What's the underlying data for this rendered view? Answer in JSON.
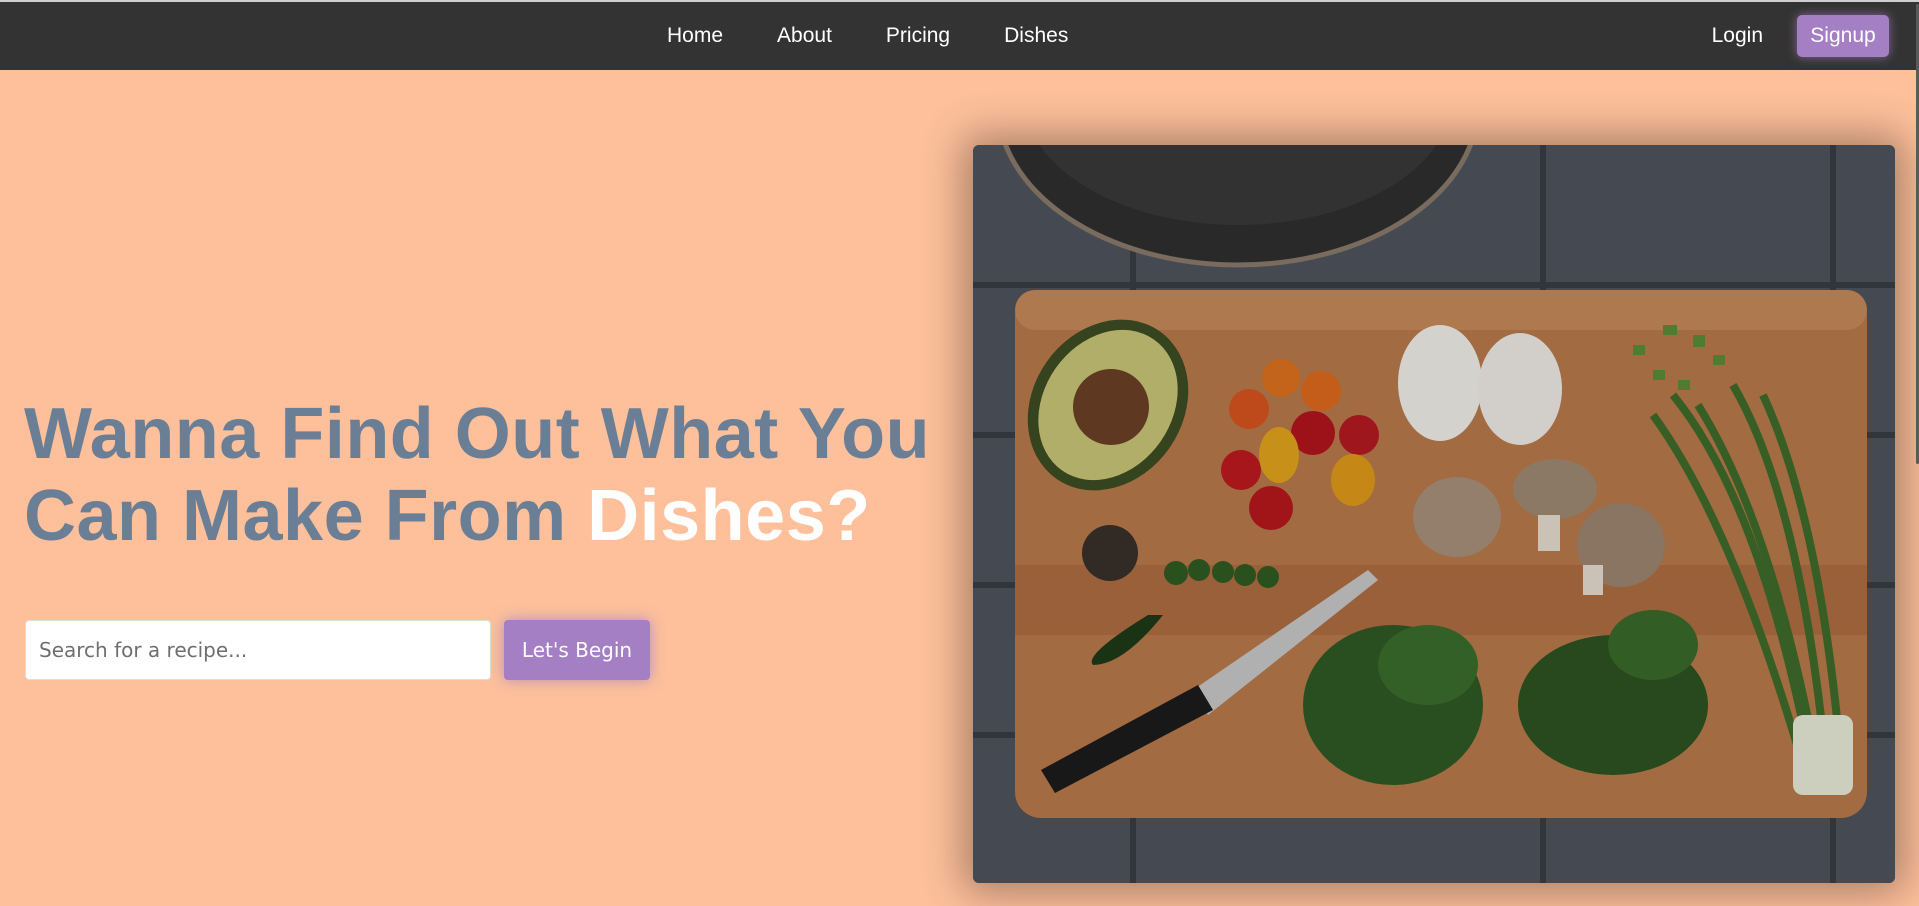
{
  "nav": {
    "links": [
      "Home",
      "About",
      "Pricing",
      "Dishes"
    ],
    "login_label": "Login",
    "signup_label": "Signup"
  },
  "hero": {
    "headline_line1": "Wanna Find Out What You",
    "headline_line2_prefix": "Can Make From ",
    "headline_accent": "Dishes?",
    "search_placeholder": "Search for a recipe...",
    "begin_label": "Let's Begin"
  },
  "colors": {
    "background": "#fdc09b",
    "navbar": "#333333",
    "accent_button": "#a57fc4",
    "headline": "#6a7f96",
    "headline_accent": "#ffffff"
  },
  "image": {
    "alt": "cutting board with vegetables"
  }
}
